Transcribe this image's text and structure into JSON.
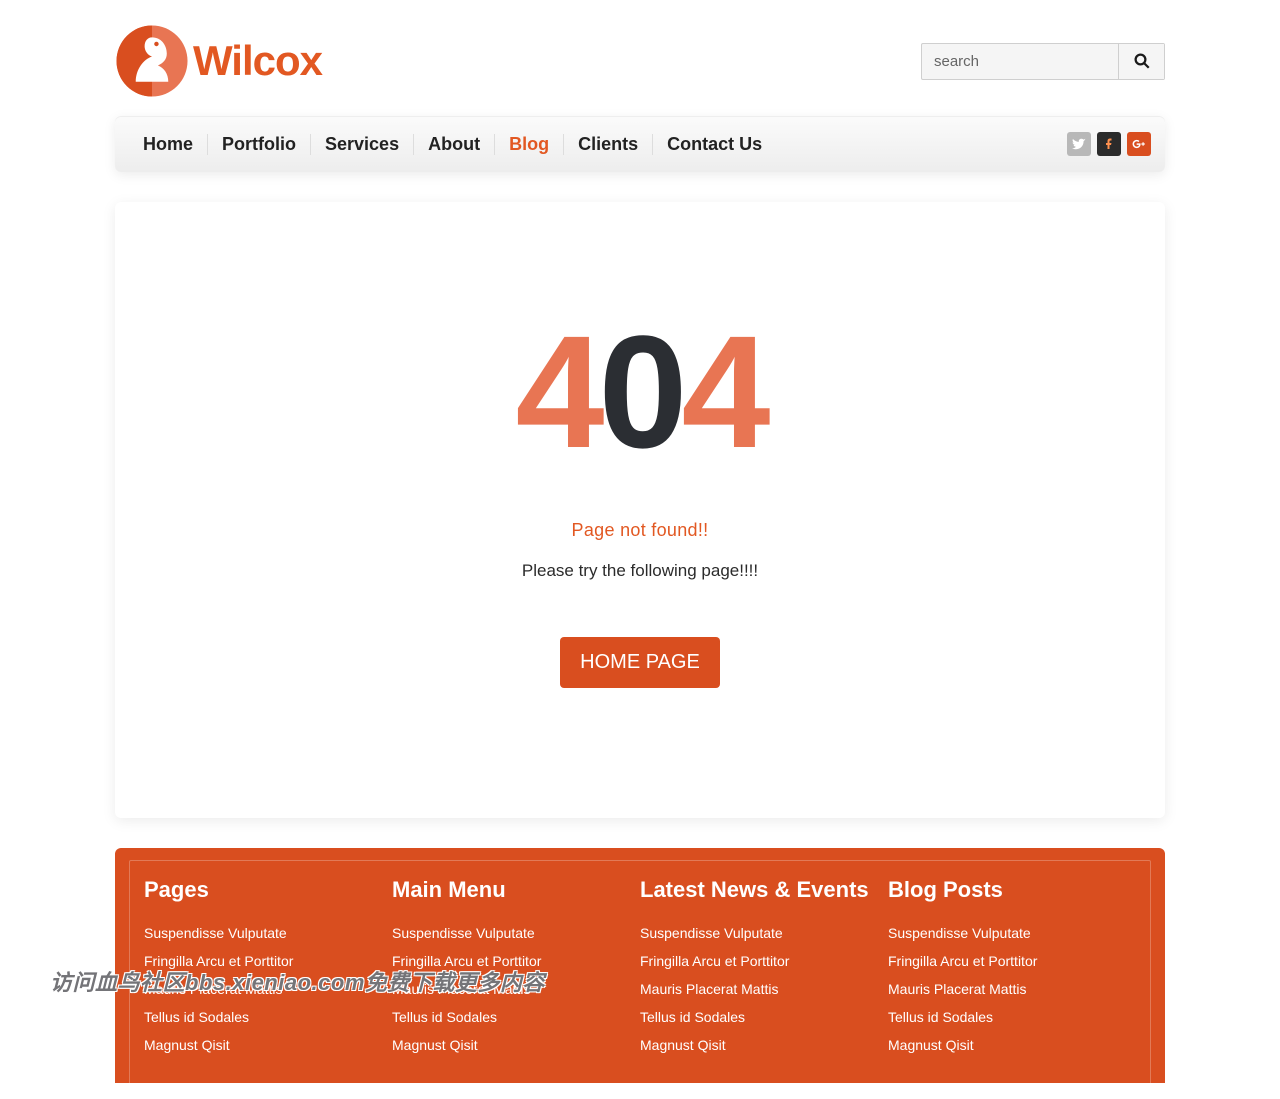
{
  "brand": {
    "name": "Wilcox"
  },
  "search": {
    "placeholder": "search"
  },
  "nav": {
    "items": [
      {
        "label": "Home",
        "active": false
      },
      {
        "label": "Portfolio",
        "active": false
      },
      {
        "label": "Services",
        "active": false
      },
      {
        "label": "About",
        "active": false
      },
      {
        "label": "Blog",
        "active": true
      },
      {
        "label": "Clients",
        "active": false
      },
      {
        "label": "Contact Us",
        "active": false
      }
    ]
  },
  "social": {
    "twitter_bg": "#b8b8b8",
    "facebook_bg": "#2b2b2b",
    "gplus_bg": "#d94e1f"
  },
  "error": {
    "d1": "4",
    "d2": "0",
    "d3": "4",
    "not_found": "Page not found!!",
    "try_text": "Please try the following page!!!!",
    "home_label": "HOME PAGE"
  },
  "footer": {
    "columns": [
      {
        "title": "Pages",
        "links": [
          "Suspendisse Vulputate",
          "Fringilla Arcu et Porttitor",
          "Mauris Placerat Mattis",
          "Tellus id Sodales",
          "Magnust Qisit"
        ]
      },
      {
        "title": "Main Menu",
        "links": [
          "Suspendisse Vulputate",
          "Fringilla Arcu et Porttitor",
          "Mauris Placerat Mattis",
          "Tellus id Sodales",
          "Magnust Qisit"
        ]
      },
      {
        "title": "Latest News & Events",
        "links": [
          "Suspendisse Vulputate",
          "Fringilla Arcu et Porttitor",
          "Mauris Placerat Mattis",
          "Tellus id Sodales",
          "Magnust Qisit"
        ]
      },
      {
        "title": "Blog Posts",
        "links": [
          "Suspendisse Vulputate",
          "Fringilla Arcu et Porttitor",
          "Mauris Placerat Mattis",
          "Tellus id Sodales",
          "Magnust Qisit"
        ]
      }
    ]
  },
  "watermark": "访问血鸟社区bbs.xieniao.com免费下载更多内容"
}
